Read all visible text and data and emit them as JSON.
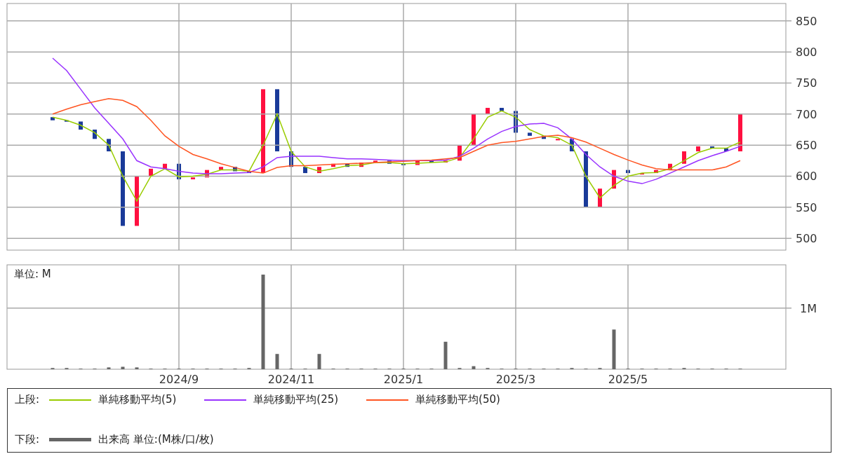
{
  "price_chart": {
    "chart_data": {
      "type": "line",
      "grid": true,
      "ylim": [
        481,
        878
      ],
      "yticks": [
        500,
        550,
        600,
        650,
        700,
        750,
        800,
        850
      ],
      "series": [
        {
          "name": "単純移動平均(5)",
          "color": "#99cc00",
          "values": [
            695,
            690,
            682,
            670,
            650,
            600,
            560,
            600,
            612,
            599,
            600,
            603,
            610,
            610,
            608,
            650,
            700,
            640,
            615,
            608,
            612,
            617,
            618,
            622,
            622,
            620,
            621,
            622,
            623,
            630,
            660,
            695,
            705,
            695,
            675,
            665,
            662,
            650,
            600,
            565,
            585,
            600,
            605,
            606,
            612,
            625,
            638,
            645,
            645,
            655
          ]
        },
        {
          "name": "単純移動平均(25)",
          "color": "#9933ff",
          "values": [
            790,
            770,
            740,
            710,
            685,
            660,
            625,
            615,
            612,
            608,
            605,
            604,
            604,
            605,
            606,
            615,
            630,
            632,
            632,
            632,
            630,
            628,
            628,
            627,
            626,
            625,
            625,
            625,
            626,
            632,
            645,
            660,
            672,
            680,
            684,
            685,
            678,
            660,
            635,
            615,
            600,
            592,
            588,
            595,
            605,
            615,
            625,
            633,
            640,
            648
          ]
        },
        {
          "name": "単純移動平均(50)",
          "color": "#ff5522",
          "values": [
            700,
            708,
            715,
            720,
            725,
            722,
            712,
            690,
            665,
            648,
            635,
            628,
            620,
            614,
            608,
            605,
            614,
            617,
            617,
            618,
            619,
            620,
            621,
            622,
            623,
            624,
            625,
            626,
            628,
            630,
            640,
            650,
            654,
            656,
            660,
            664,
            666,
            662,
            655,
            645,
            635,
            626,
            618,
            612,
            610,
            610,
            610,
            610,
            615,
            625
          ]
        }
      ]
    }
  },
  "volume_chart": {
    "chart_data": {
      "type": "bar",
      "grid": true,
      "ylim": [
        0,
        1.71
      ],
      "ylabel": "単位: M",
      "yticks": [
        {
          "value": 1,
          "label": "1M"
        }
      ],
      "categories": [
        null,
        null,
        null,
        null,
        null,
        null,
        null,
        null,
        null,
        "2024/9",
        null,
        null,
        null,
        null,
        null,
        null,
        null,
        "2024/11",
        null,
        null,
        null,
        null,
        null,
        null,
        null,
        "2025/1",
        null,
        null,
        null,
        null,
        null,
        null,
        null,
        "2025/3",
        null,
        null,
        null,
        null,
        null,
        null,
        null,
        "2025/5",
        null,
        null,
        null,
        null,
        null,
        null,
        null,
        null
      ],
      "series": [
        {
          "name": "出来高 単位:(M株/口/枚)",
          "color": "#666666",
          "values": [
            0.02,
            0.02,
            0.01,
            0.01,
            0.03,
            0.04,
            0.03,
            0.01,
            0.01,
            0.01,
            0.01,
            0.01,
            0.01,
            0.01,
            0.02,
            1.55,
            0.25,
            0.01,
            0.01,
            0.25,
            0.01,
            0.01,
            0.01,
            0.01,
            0.01,
            0.01,
            0.01,
            0.01,
            0.45,
            0.02,
            0.05,
            0.02,
            0.01,
            0.01,
            0.01,
            0.01,
            0.01,
            0.02,
            0.01,
            0.02,
            0.65,
            0.01,
            0.01,
            0.01,
            0.01,
            0.02,
            0.01,
            0.01,
            0.01,
            0.01
          ]
        }
      ]
    }
  },
  "legend": {
    "upper_label": "上段:",
    "lower_label": "下段:"
  }
}
